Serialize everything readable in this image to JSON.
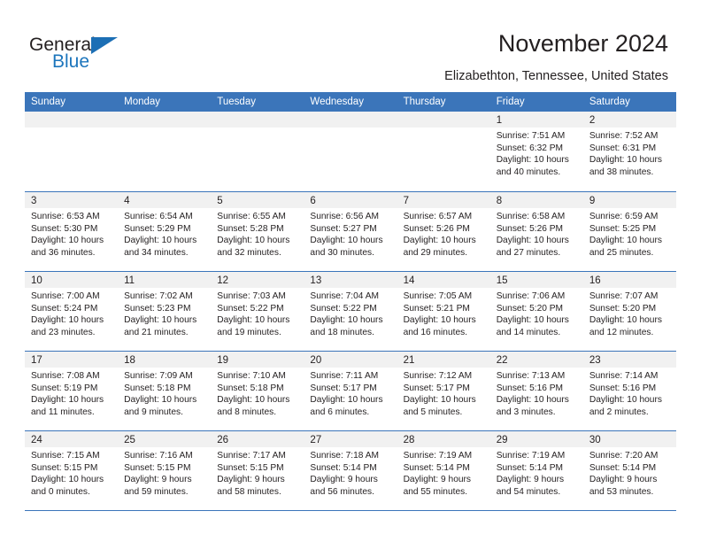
{
  "brand": {
    "name_top": "General",
    "name_bottom": "Blue",
    "accent_color": "#1c75bc",
    "triangle_color": "#1c6fb5"
  },
  "header": {
    "title": "November 2024",
    "subtitle": "Elizabethton, Tennessee, United States"
  },
  "calendar": {
    "header_bg": "#3b75ba",
    "weekdays": [
      "Sunday",
      "Monday",
      "Tuesday",
      "Wednesday",
      "Thursday",
      "Friday",
      "Saturday"
    ],
    "weeks": [
      [
        {
          "day": "",
          "empty": true
        },
        {
          "day": "",
          "empty": true
        },
        {
          "day": "",
          "empty": true
        },
        {
          "day": "",
          "empty": true
        },
        {
          "day": "",
          "empty": true
        },
        {
          "day": "1",
          "sunrise": "Sunrise: 7:51 AM",
          "sunset": "Sunset: 6:32 PM",
          "daylight": "Daylight: 10 hours and 40 minutes."
        },
        {
          "day": "2",
          "sunrise": "Sunrise: 7:52 AM",
          "sunset": "Sunset: 6:31 PM",
          "daylight": "Daylight: 10 hours and 38 minutes."
        }
      ],
      [
        {
          "day": "3",
          "sunrise": "Sunrise: 6:53 AM",
          "sunset": "Sunset: 5:30 PM",
          "daylight": "Daylight: 10 hours and 36 minutes."
        },
        {
          "day": "4",
          "sunrise": "Sunrise: 6:54 AM",
          "sunset": "Sunset: 5:29 PM",
          "daylight": "Daylight: 10 hours and 34 minutes."
        },
        {
          "day": "5",
          "sunrise": "Sunrise: 6:55 AM",
          "sunset": "Sunset: 5:28 PM",
          "daylight": "Daylight: 10 hours and 32 minutes."
        },
        {
          "day": "6",
          "sunrise": "Sunrise: 6:56 AM",
          "sunset": "Sunset: 5:27 PM",
          "daylight": "Daylight: 10 hours and 30 minutes."
        },
        {
          "day": "7",
          "sunrise": "Sunrise: 6:57 AM",
          "sunset": "Sunset: 5:26 PM",
          "daylight": "Daylight: 10 hours and 29 minutes."
        },
        {
          "day": "8",
          "sunrise": "Sunrise: 6:58 AM",
          "sunset": "Sunset: 5:26 PM",
          "daylight": "Daylight: 10 hours and 27 minutes."
        },
        {
          "day": "9",
          "sunrise": "Sunrise: 6:59 AM",
          "sunset": "Sunset: 5:25 PM",
          "daylight": "Daylight: 10 hours and 25 minutes."
        }
      ],
      [
        {
          "day": "10",
          "sunrise": "Sunrise: 7:00 AM",
          "sunset": "Sunset: 5:24 PM",
          "daylight": "Daylight: 10 hours and 23 minutes."
        },
        {
          "day": "11",
          "sunrise": "Sunrise: 7:02 AM",
          "sunset": "Sunset: 5:23 PM",
          "daylight": "Daylight: 10 hours and 21 minutes."
        },
        {
          "day": "12",
          "sunrise": "Sunrise: 7:03 AM",
          "sunset": "Sunset: 5:22 PM",
          "daylight": "Daylight: 10 hours and 19 minutes."
        },
        {
          "day": "13",
          "sunrise": "Sunrise: 7:04 AM",
          "sunset": "Sunset: 5:22 PM",
          "daylight": "Daylight: 10 hours and 18 minutes."
        },
        {
          "day": "14",
          "sunrise": "Sunrise: 7:05 AM",
          "sunset": "Sunset: 5:21 PM",
          "daylight": "Daylight: 10 hours and 16 minutes."
        },
        {
          "day": "15",
          "sunrise": "Sunrise: 7:06 AM",
          "sunset": "Sunset: 5:20 PM",
          "daylight": "Daylight: 10 hours and 14 minutes."
        },
        {
          "day": "16",
          "sunrise": "Sunrise: 7:07 AM",
          "sunset": "Sunset: 5:20 PM",
          "daylight": "Daylight: 10 hours and 12 minutes."
        }
      ],
      [
        {
          "day": "17",
          "sunrise": "Sunrise: 7:08 AM",
          "sunset": "Sunset: 5:19 PM",
          "daylight": "Daylight: 10 hours and 11 minutes."
        },
        {
          "day": "18",
          "sunrise": "Sunrise: 7:09 AM",
          "sunset": "Sunset: 5:18 PM",
          "daylight": "Daylight: 10 hours and 9 minutes."
        },
        {
          "day": "19",
          "sunrise": "Sunrise: 7:10 AM",
          "sunset": "Sunset: 5:18 PM",
          "daylight": "Daylight: 10 hours and 8 minutes."
        },
        {
          "day": "20",
          "sunrise": "Sunrise: 7:11 AM",
          "sunset": "Sunset: 5:17 PM",
          "daylight": "Daylight: 10 hours and 6 minutes."
        },
        {
          "day": "21",
          "sunrise": "Sunrise: 7:12 AM",
          "sunset": "Sunset: 5:17 PM",
          "daylight": "Daylight: 10 hours and 5 minutes."
        },
        {
          "day": "22",
          "sunrise": "Sunrise: 7:13 AM",
          "sunset": "Sunset: 5:16 PM",
          "daylight": "Daylight: 10 hours and 3 minutes."
        },
        {
          "day": "23",
          "sunrise": "Sunrise: 7:14 AM",
          "sunset": "Sunset: 5:16 PM",
          "daylight": "Daylight: 10 hours and 2 minutes."
        }
      ],
      [
        {
          "day": "24",
          "sunrise": "Sunrise: 7:15 AM",
          "sunset": "Sunset: 5:15 PM",
          "daylight": "Daylight: 10 hours and 0 minutes."
        },
        {
          "day": "25",
          "sunrise": "Sunrise: 7:16 AM",
          "sunset": "Sunset: 5:15 PM",
          "daylight": "Daylight: 9 hours and 59 minutes."
        },
        {
          "day": "26",
          "sunrise": "Sunrise: 7:17 AM",
          "sunset": "Sunset: 5:15 PM",
          "daylight": "Daylight: 9 hours and 58 minutes."
        },
        {
          "day": "27",
          "sunrise": "Sunrise: 7:18 AM",
          "sunset": "Sunset: 5:14 PM",
          "daylight": "Daylight: 9 hours and 56 minutes."
        },
        {
          "day": "28",
          "sunrise": "Sunrise: 7:19 AM",
          "sunset": "Sunset: 5:14 PM",
          "daylight": "Daylight: 9 hours and 55 minutes."
        },
        {
          "day": "29",
          "sunrise": "Sunrise: 7:19 AM",
          "sunset": "Sunset: 5:14 PM",
          "daylight": "Daylight: 9 hours and 54 minutes."
        },
        {
          "day": "30",
          "sunrise": "Sunrise: 7:20 AM",
          "sunset": "Sunset: 5:14 PM",
          "daylight": "Daylight: 9 hours and 53 minutes."
        }
      ]
    ]
  }
}
